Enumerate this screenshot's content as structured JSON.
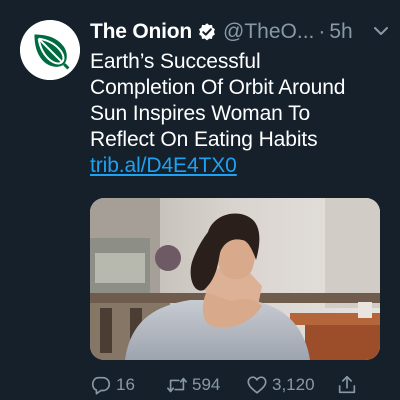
{
  "tweet": {
    "author_name": "The Onion",
    "handle": "@TheO...",
    "separator": "·",
    "time": "5h",
    "text_lines": [
      "Earth’s Successful",
      "Completion Of Orbit Around",
      "Sun Inspires Woman To",
      "Reflect On Eating Habits"
    ],
    "link": "trib.al/D4E4TX0",
    "stats": {
      "replies": "16",
      "retweets": "594",
      "likes": "3,120"
    }
  },
  "colors": {
    "background": "#15202b",
    "secondary_text": "#8899a6",
    "link": "#1da1f2",
    "verified": "#1da1f2",
    "onion_green": "#006b3f"
  },
  "icons": {
    "avatar": "onion-logo-icon",
    "verified": "verified-badge-icon",
    "menu": "chevron-down-icon",
    "reply": "reply-icon",
    "retweet": "retweet-icon",
    "like": "heart-icon",
    "share": "share-icon"
  }
}
